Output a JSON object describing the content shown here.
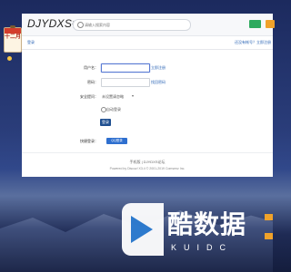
{
  "header": {
    "logo": "DJYDXS",
    "logo_suffix": "论坛",
    "search_placeholder": "请输入搜索内容"
  },
  "breadcrumb": {
    "title": "登录",
    "right_links": "还没有帐号？立即注册"
  },
  "form": {
    "username_label": "用户名：",
    "username_link": "立即注册",
    "password_label": "密码：",
    "password_link": "找回密码",
    "question_label": "安全提问：",
    "question_value": "未设置请忽略",
    "remember_label": "自动登录",
    "submit_label": "登录",
    "quick_label": "快捷登录：",
    "quick_button": "QQ登录"
  },
  "footer": {
    "line1": "手机版 | DJYDXS论坛",
    "line2": "Powered by Discuz! X3.4 © 2001-2019 Comsenz Inc."
  },
  "sidebar": {
    "calendar_text": "十二月"
  },
  "watermark": {
    "text": "酷数据",
    "sub": "KUIDC"
  },
  "colors": {
    "accent": "#2a64b5",
    "login_green": "#2eaa5e",
    "register_orange": "#f0a22a",
    "primary_button": "#1f4f90"
  }
}
